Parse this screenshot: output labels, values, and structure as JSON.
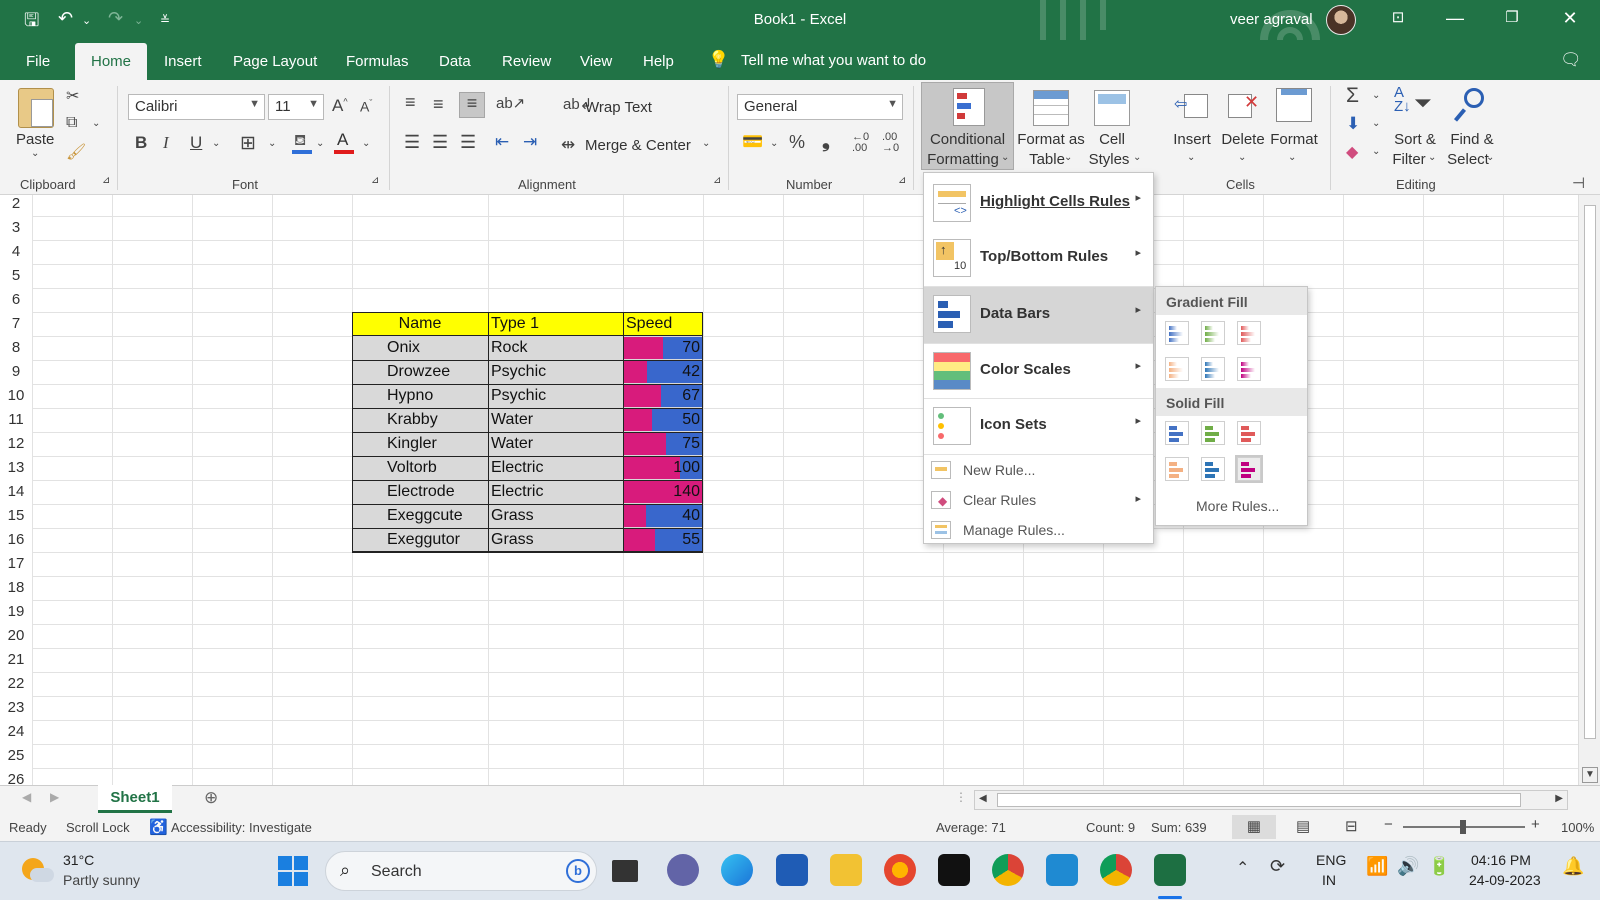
{
  "window": {
    "title": "Book1  -  Excel",
    "user": "veer agraval"
  },
  "menu_tabs": [
    "File",
    "Home",
    "Insert",
    "Page Layout",
    "Formulas",
    "Data",
    "Review",
    "View",
    "Help"
  ],
  "tell_me": "Tell me what you want to do",
  "ribbon": {
    "clipboard": {
      "paste": "Paste",
      "label": "Clipboard"
    },
    "font": {
      "name": "Calibri",
      "size": "11",
      "label": "Font",
      "bold": "B",
      "italic": "I",
      "underline": "U"
    },
    "alignment": {
      "wrap": "Wrap Text",
      "merge": "Merge & Center",
      "label": "Alignment"
    },
    "number": {
      "format": "General",
      "label": "Number",
      "percent": "%",
      "comma": "❟"
    },
    "styles": {
      "cf_line1": "Conditional",
      "cf_line2": "Formatting",
      "fat_line1": "Format as",
      "fat_line2": "Table",
      "cs_line1": "Cell",
      "cs_line2": "Styles"
    },
    "cells": {
      "insert": "Insert",
      "delete": "Delete",
      "format": "Format",
      "label": "Cells"
    },
    "editing": {
      "sort_line1": "Sort &",
      "sort_line2": "Filter",
      "find_line1": "Find &",
      "find_line2": "Select",
      "label": "Editing"
    }
  },
  "rows": [
    "2",
    "3",
    "4",
    "5",
    "6",
    "7",
    "8",
    "9",
    "10",
    "11",
    "12",
    "13",
    "14",
    "15",
    "16",
    "17",
    "18",
    "19",
    "20",
    "21",
    "22",
    "23",
    "24",
    "25",
    "26"
  ],
  "table": {
    "headers": {
      "name": "Name",
      "type": "Type 1",
      "speed": "Speed"
    },
    "records": [
      {
        "name": "Onix",
        "type": "Rock",
        "speed": "70",
        "speed_value": 70
      },
      {
        "name": "Drowzee",
        "type": "Psychic",
        "speed": "42",
        "speed_value": 42
      },
      {
        "name": "Hypno",
        "type": "Psychic",
        "speed": "67",
        "speed_value": 67
      },
      {
        "name": "Krabby",
        "type": "Water",
        "speed": "50",
        "speed_value": 50
      },
      {
        "name": "Kingler",
        "type": "Water",
        "speed": "75",
        "speed_value": 75
      },
      {
        "name": "Voltorb",
        "type": "Electric",
        "speed": "100",
        "speed_value": 100
      },
      {
        "name": "Electrode",
        "type": "Electric",
        "speed": "140",
        "speed_value": 140
      },
      {
        "name": "Exeggcute",
        "type": "Grass",
        "speed": "40",
        "speed_value": 40
      },
      {
        "name": "Exeggutor",
        "type": "Grass",
        "speed": "55",
        "speed_value": 55
      }
    ],
    "header_color": "#ffff00",
    "bar_color": "#d81b7c",
    "bar_background": "#3967cc"
  },
  "cf_menu": {
    "items": [
      {
        "label": "Highlight Cells Rules"
      },
      {
        "label": "Top/Bottom Rules"
      },
      {
        "label": "Data Bars"
      },
      {
        "label": "Color Scales"
      },
      {
        "label": "Icon Sets"
      }
    ],
    "new_rule": "New Rule...",
    "clear_rules": "Clear Rules",
    "manage_rules": "Manage Rules..."
  },
  "data_bars_menu": {
    "gradient_fill": "Gradient Fill",
    "solid_fill": "Solid Fill",
    "more_rules": "More Rules...",
    "swatch_colors": [
      "#4472c4",
      "#70ad47",
      "#e05a5a",
      "#f4b183",
      "#2e75b6",
      "#c00080"
    ]
  },
  "sheet_tab": "Sheet1",
  "status": {
    "ready": "Ready",
    "scroll_lock": "Scroll Lock",
    "accessibility": "Accessibility: Investigate",
    "average": "Average: 71",
    "count": "Count: 9",
    "sum": "Sum: 639",
    "zoom": "100%"
  },
  "taskbar": {
    "weather_temp": "31°C",
    "weather_desc": "Partly sunny",
    "search": "Search",
    "lang1": "ENG",
    "lang2": "IN",
    "time": "04:16 PM",
    "date": "24-09-2023"
  }
}
